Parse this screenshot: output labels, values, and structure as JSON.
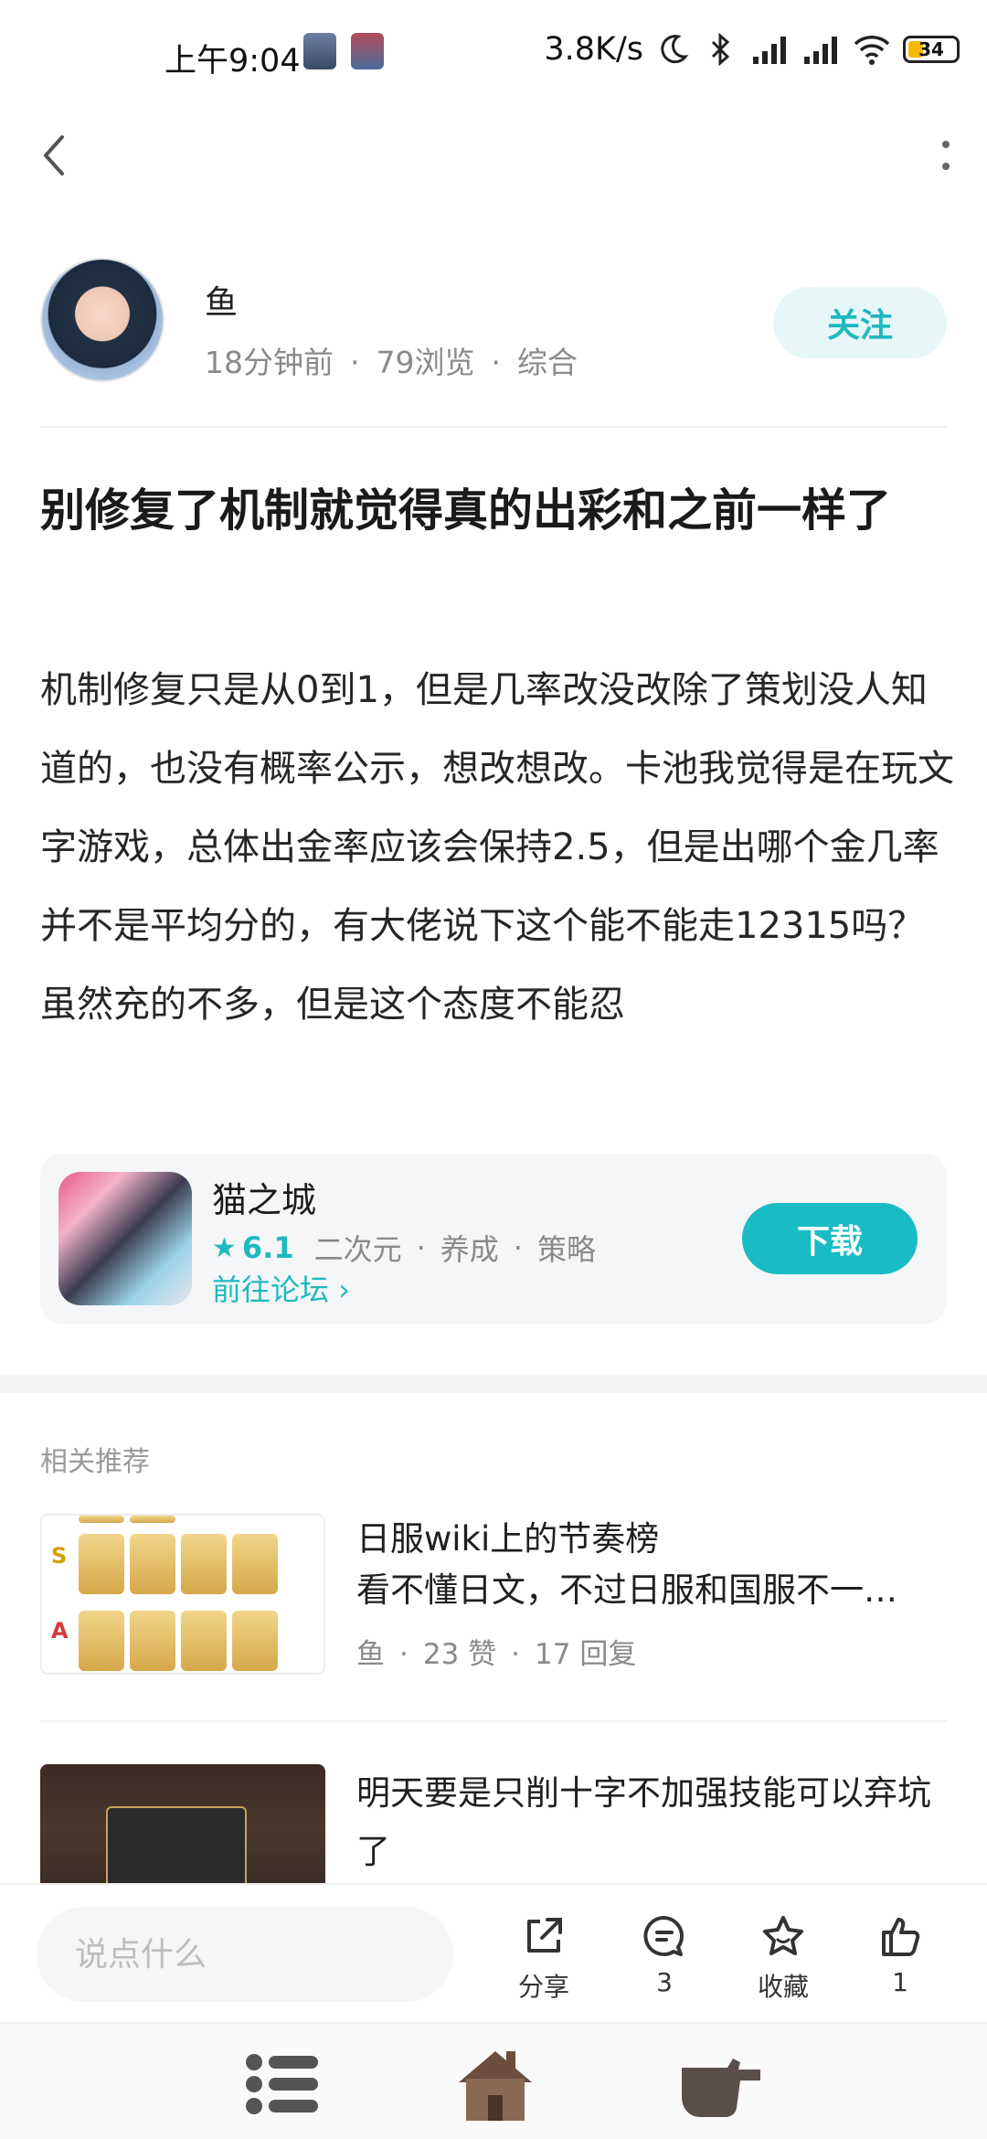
{
  "status_bar": {
    "time": "上午9:04",
    "net_speed": "3.8K/s",
    "battery": "34"
  },
  "author": {
    "name": "鱼",
    "time_ago": "18分钟前",
    "views": "79浏览",
    "category": "综合",
    "follow_label": "关注"
  },
  "post": {
    "title": "别修复了机制就觉得真的出彩和之前一样了",
    "body": "机制修复只是从0到1，但是几率改没改除了策划没人知道的，也没有概率公示，想改想改。卡池我觉得是在玩文字游戏，总体出金率应该会保持2.5，但是出哪个金几率并不是平均分的，有大佬说下这个能不能走12315吗？虽然充的不多，但是这个态度不能忍"
  },
  "game_card": {
    "name": "猫之城",
    "score": "6.1",
    "tags": [
      "二次元",
      "养成",
      "策略"
    ],
    "forum_link": "前往论坛",
    "download_label": "下载"
  },
  "recommend": {
    "header": "相关推荐",
    "items": [
      {
        "title": "日服wiki上的节奏榜",
        "subtitle": "看不懂日文，不过日服和国服不一…",
        "author": "鱼",
        "likes": "23 赞",
        "replies": "17 回复"
      },
      {
        "title": "明天要是只削十字不加强技能可以弃坑了"
      }
    ]
  },
  "action_bar": {
    "comment_placeholder": "说点什么",
    "share_label": "分享",
    "comment_count": "3",
    "favorite_label": "收藏",
    "like_count": "1"
  },
  "colors": {
    "accent": "#1fb9c0",
    "follow_bg": "#e7f7f7"
  }
}
